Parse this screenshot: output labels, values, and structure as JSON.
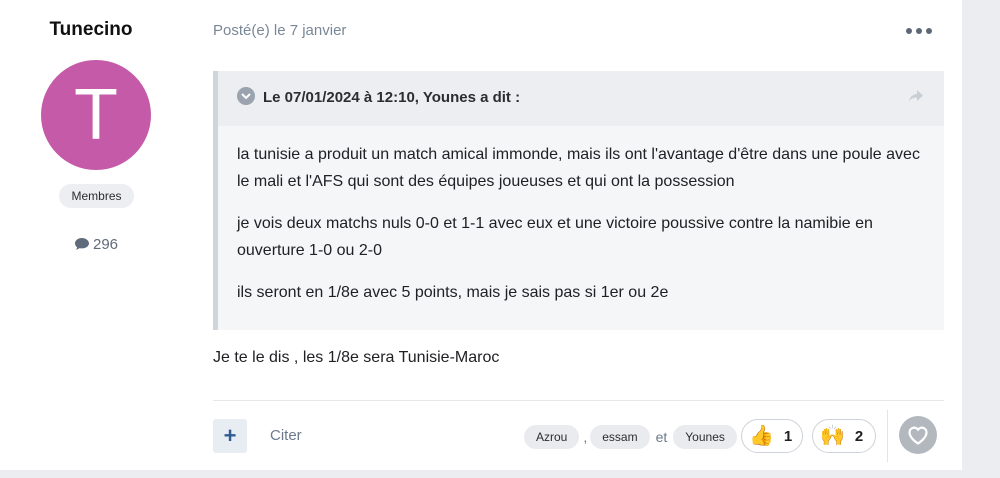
{
  "author": {
    "name": "Tunecino",
    "avatar_letter": "T",
    "avatar_color": "#c55ba8",
    "role": "Membres",
    "post_count": "296",
    "post_count_icon": "speech-bubble-icon"
  },
  "post": {
    "date_prefix": "Posté(e) le",
    "date": "7 janvier",
    "more_icon": "ellipsis-icon"
  },
  "quote": {
    "header": "Le 07/01/2024 à 12:10, Younes a dit :",
    "paragraphs": [
      "la tunisie a produit un match amical immonde, mais ils ont l'avantage d'être dans une poule avec le mali et l'AFS qui sont des équipes joueuses et qui ont la possession",
      "je vois deux matchs nuls 0-0 et 1-1 avec eux et une victoire poussive contre la namibie en ouverture 1-0 ou 2-0",
      "ils seront en 1/8e avec 5 points, mais je sais pas si 1er ou 2e"
    ]
  },
  "reply_text": "Je te le dis , les 1/8e sera Tunisie-Maroc",
  "footer": {
    "multiquote_label": "+",
    "quote_label": "Citer",
    "reactors": [
      "Azrou",
      "essam",
      "Younes"
    ],
    "reactor_sep_comma": ",",
    "reactor_sep_and": "et",
    "reactions": [
      {
        "emoji": "👍",
        "icon": "thumbs-up-icon",
        "count": "1"
      },
      {
        "emoji": "🙌",
        "icon": "raised-hands-icon",
        "count": "2"
      }
    ],
    "like_icon": "heart-icon"
  }
}
